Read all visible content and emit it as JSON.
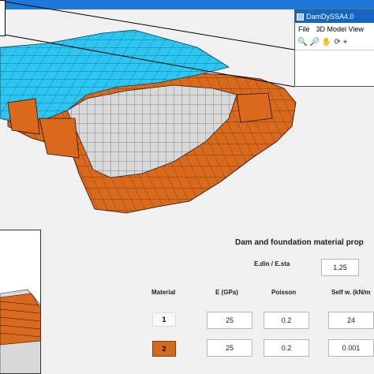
{
  "window": {
    "title": "DamDySSA4.0",
    "menu": [
      "File",
      "3D Model View"
    ],
    "tools": [
      "zoom-in-icon",
      "zoom-out-icon",
      "pan-icon",
      "rotate-icon",
      "datatip-icon"
    ]
  },
  "panel": {
    "title": "Dam and foundation material prop",
    "edin_label": "E.din / E.sta",
    "edin_value": "1.25",
    "headers": {
      "material": "Material",
      "e": "E (GPa)",
      "poisson": "Poisson",
      "selfw": "Self w. (kN/m"
    },
    "rows": [
      {
        "id": "1",
        "color": "#f7f7ff",
        "e": "25",
        "poisson": "0.2",
        "selfw": "24"
      },
      {
        "id": "2",
        "color": "#d46a1c",
        "e": "25",
        "poisson": "0.2",
        "selfw": "0.001"
      }
    ]
  },
  "colors": {
    "dam": "#2bc6f2",
    "foundation": "#d8691d",
    "reservoir": "#d8d8d8",
    "titlebar": "#1565c8"
  }
}
